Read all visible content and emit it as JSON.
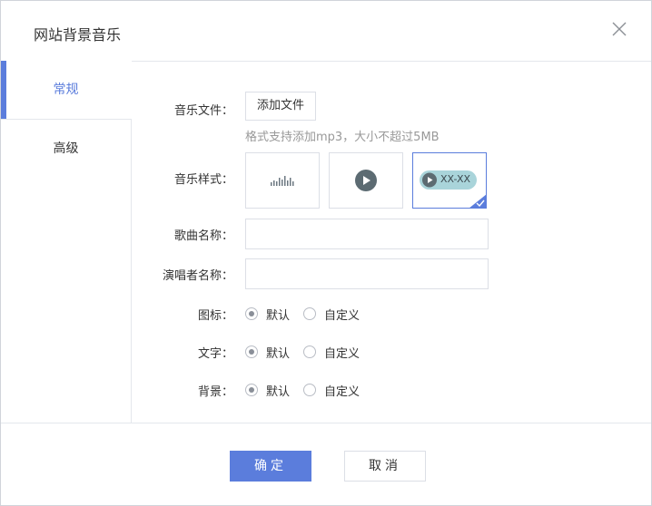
{
  "dialog": {
    "title": "网站背景音乐",
    "close_icon": "close-icon"
  },
  "sidebar": {
    "items": [
      {
        "label": "常规",
        "active": true
      },
      {
        "label": "高级",
        "active": false
      }
    ]
  },
  "form": {
    "music_file": {
      "label": "音乐文件：",
      "button": "添加文件",
      "hint": "格式支持添加mp3，大小不超过5MB"
    },
    "music_style": {
      "label": "音乐样式：",
      "options": [
        {
          "icon": "waveform-icon",
          "selected": false
        },
        {
          "icon": "play-circle-icon",
          "selected": false
        },
        {
          "icon": "play-pill-icon",
          "text": "XX-XX",
          "selected": true
        }
      ]
    },
    "song_name": {
      "label": "歌曲名称：",
      "value": "",
      "placeholder": ""
    },
    "singer_name": {
      "label": "演唱者名称：",
      "value": "",
      "placeholder": ""
    },
    "icon": {
      "label": "图标：",
      "options": [
        "默认",
        "自定义"
      ],
      "selected": "默认"
    },
    "text": {
      "label": "文字：",
      "options": [
        "默认",
        "自定义"
      ],
      "selected": "默认"
    },
    "background": {
      "label": "背景：",
      "options": [
        "默认",
        "自定义"
      ],
      "selected": "默认"
    }
  },
  "footer": {
    "confirm": "确定",
    "cancel": "取消"
  },
  "colors": {
    "accent": "#5b7ddc",
    "pill_bg": "#a9d4da",
    "play_dark": "#5c6b72"
  }
}
